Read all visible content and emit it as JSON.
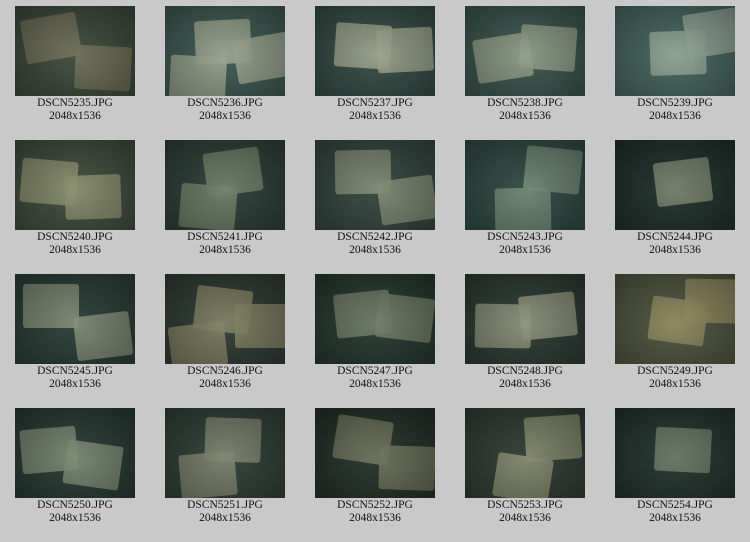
{
  "gallery": {
    "items": [
      {
        "filename": "DSCN5235.JPG",
        "dimensions": "2048x1536",
        "bg": "#3c4a3a",
        "slab": "#6e6f57"
      },
      {
        "filename": "DSCN5236.JPG",
        "dimensions": "2048x1536",
        "bg": "#3d5a52",
        "slab": "#9aa48e"
      },
      {
        "filename": "DSCN5237.JPG",
        "dimensions": "2048x1536",
        "bg": "#344c45",
        "slab": "#9aa38a"
      },
      {
        "filename": "DSCN5238.JPG",
        "dimensions": "2048x1536",
        "bg": "#3a554d",
        "slab": "#8f9c86"
      },
      {
        "filename": "DSCN5239.JPG",
        "dimensions": "2048x1536",
        "bg": "#45665f",
        "slab": "#8fa597"
      },
      {
        "filename": "DSCN5240.JPG",
        "dimensions": "2048x1536",
        "bg": "#3f4c3c",
        "slab": "#8a8f6c"
      },
      {
        "filename": "DSCN5241.JPG",
        "dimensions": "2048x1536",
        "bg": "#2c3e37",
        "slab": "#6d7d64"
      },
      {
        "filename": "DSCN5242.JPG",
        "dimensions": "2048x1536",
        "bg": "#33463f",
        "slab": "#7e8b72"
      },
      {
        "filename": "DSCN5243.JPG",
        "dimensions": "2048x1536",
        "bg": "#2f4a43",
        "slab": "#6f8775"
      },
      {
        "filename": "DSCN5244.JPG",
        "dimensions": "2048x1536",
        "bg": "#1f302b",
        "slab": "#76836a"
      },
      {
        "filename": "DSCN5245.JPG",
        "dimensions": "2048x1536",
        "bg": "#2a3d37",
        "slab": "#7e8b73"
      },
      {
        "filename": "DSCN5246.JPG",
        "dimensions": "2048x1536",
        "bg": "#2e3b33",
        "slab": "#7f7f5f"
      },
      {
        "filename": "DSCN5247.JPG",
        "dimensions": "2048x1536",
        "bg": "#25382f",
        "slab": "#6e7c63"
      },
      {
        "filename": "DSCN5248.JPG",
        "dimensions": "2048x1536",
        "bg": "#2b3a33",
        "slab": "#8b9178"
      },
      {
        "filename": "DSCN5249.JPG",
        "dimensions": "2048x1536",
        "bg": "#4f553e",
        "slab": "#8f8a5e"
      },
      {
        "filename": "DSCN5250.JPG",
        "dimensions": "2048x1536",
        "bg": "#273a33",
        "slab": "#7a8870"
      },
      {
        "filename": "DSCN5251.JPG",
        "dimensions": "2048x1536",
        "bg": "#2e3f36",
        "slab": "#7b826a"
      },
      {
        "filename": "DSCN5252.JPG",
        "dimensions": "2048x1536",
        "bg": "#233128",
        "slab": "#6a7258"
      },
      {
        "filename": "DSCN5253.JPG",
        "dimensions": "2048x1536",
        "bg": "#2f3c32",
        "slab": "#858a6c"
      },
      {
        "filename": "DSCN5254.JPG",
        "dimensions": "2048x1536",
        "bg": "#22332d",
        "slab": "#6a7a66"
      }
    ]
  }
}
